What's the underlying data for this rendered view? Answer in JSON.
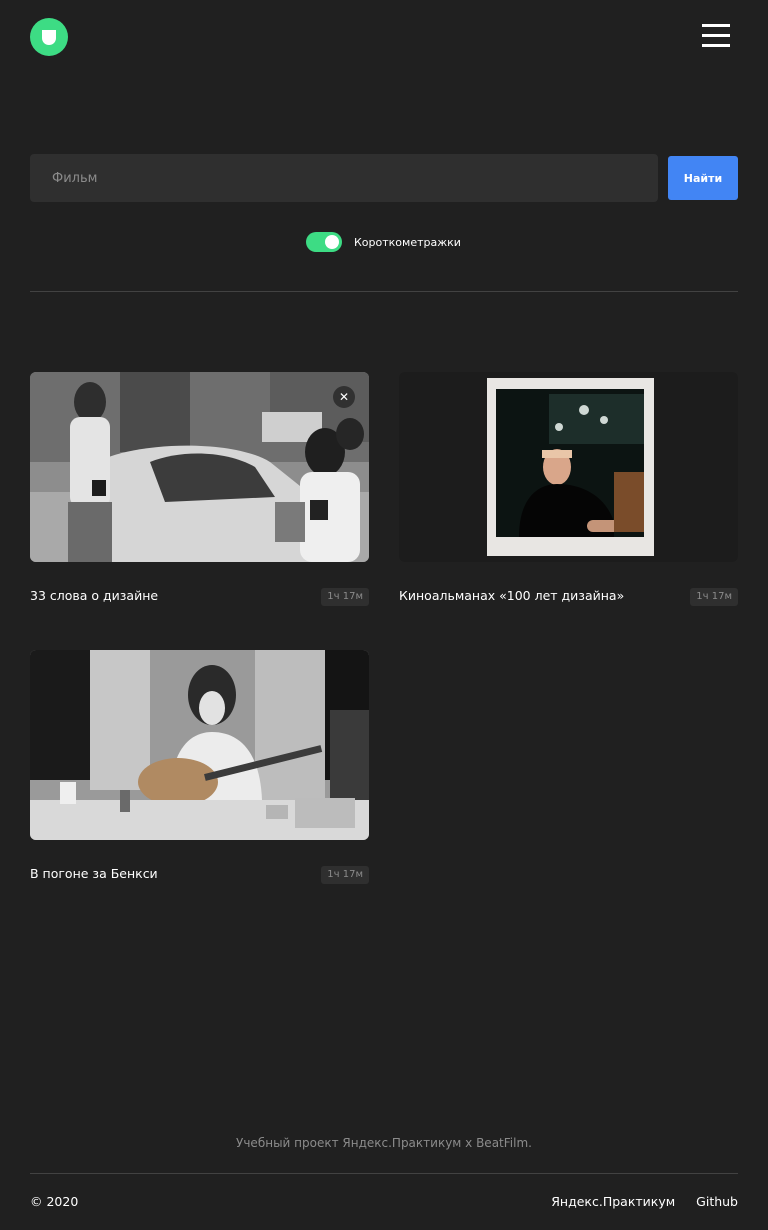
{
  "header": {
    "logo_icon": "logo-icon",
    "menu_icon": "hamburger-menu-icon"
  },
  "search": {
    "placeholder": "Фильм",
    "value": "",
    "button_label": "Найти"
  },
  "filter": {
    "label": "Короткометражки",
    "enabled": true
  },
  "movies": [
    {
      "title": "33 слова о дизайне",
      "duration": "1ч 17м",
      "has_delete_button": true
    },
    {
      "title": "Киноальманах «100 лет дизайна»",
      "duration": "1ч 17м"
    },
    {
      "title": "В погоне за Бенкси",
      "duration": "1ч 17м"
    }
  ],
  "footer": {
    "project_text": "Учебный проект Яндекс.Практикум х BeatFilm.",
    "copyright": "© 2020",
    "links": [
      "Яндекс.Практикум",
      "Github"
    ]
  },
  "colors": {
    "background": "#202020",
    "accent_green": "#3ddc84",
    "accent_blue": "#4285f4",
    "input_background": "#2f2f2f",
    "muted_text": "#8b8b8b"
  }
}
